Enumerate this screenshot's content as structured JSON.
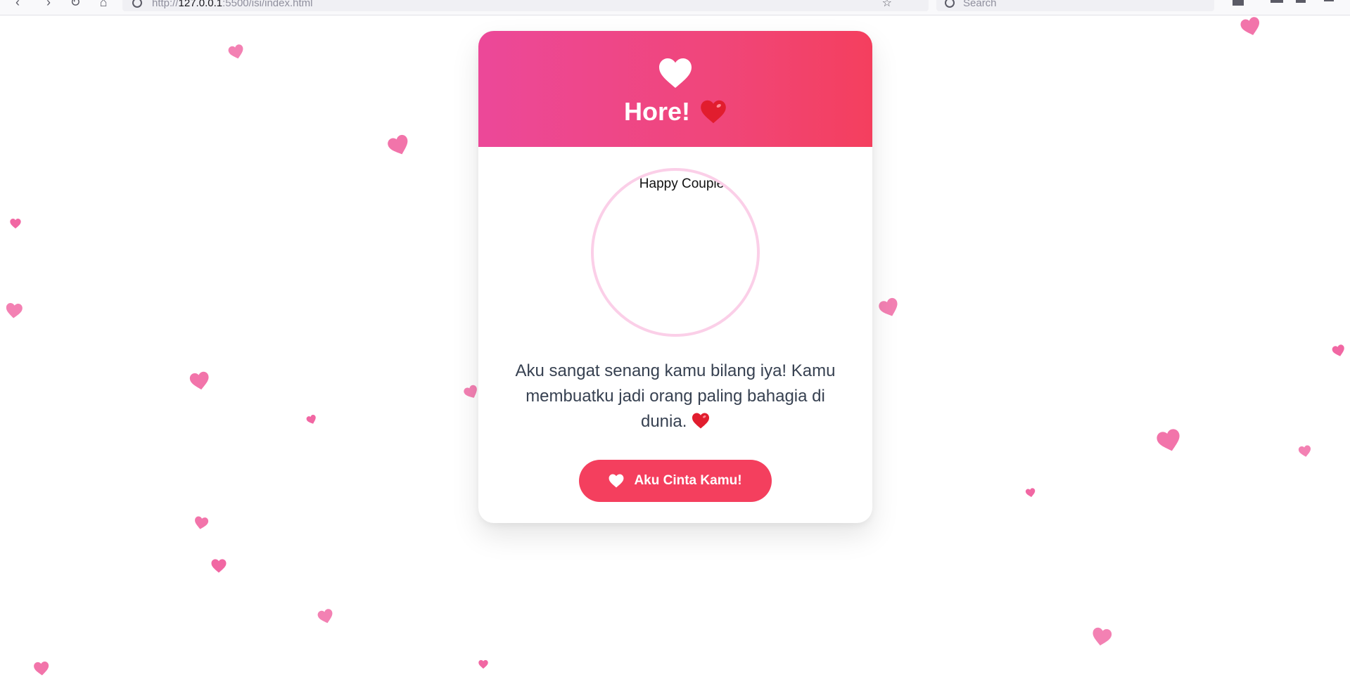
{
  "browser": {
    "url_prefix": "http://",
    "url_host": "127.0.0.1",
    "url_rest": ":5500/isi/index.html",
    "search_placeholder": "Search"
  },
  "card": {
    "title": "Hore!",
    "photo_alt": "Happy Couple",
    "message": "Aku sangat senang kamu bilang iya! Kamu membuatku jadi orang paling bahagia di dunia.",
    "button_label": "Aku Cinta Kamu!"
  },
  "colors": {
    "header_gradient_start": "#ec4899",
    "header_gradient_end": "#f43f5e",
    "button": "#f43f5e",
    "photo_border": "#fbcfe8",
    "floating_heart": "#f0589a",
    "emoji_heart": "#e11d2e"
  },
  "icons": {
    "header": "heart-icon",
    "title_emoji": "red-heart-emoji",
    "message_emoji": "red-heart-emoji",
    "button": "heart-icon",
    "background": "floating-heart-icon"
  }
}
